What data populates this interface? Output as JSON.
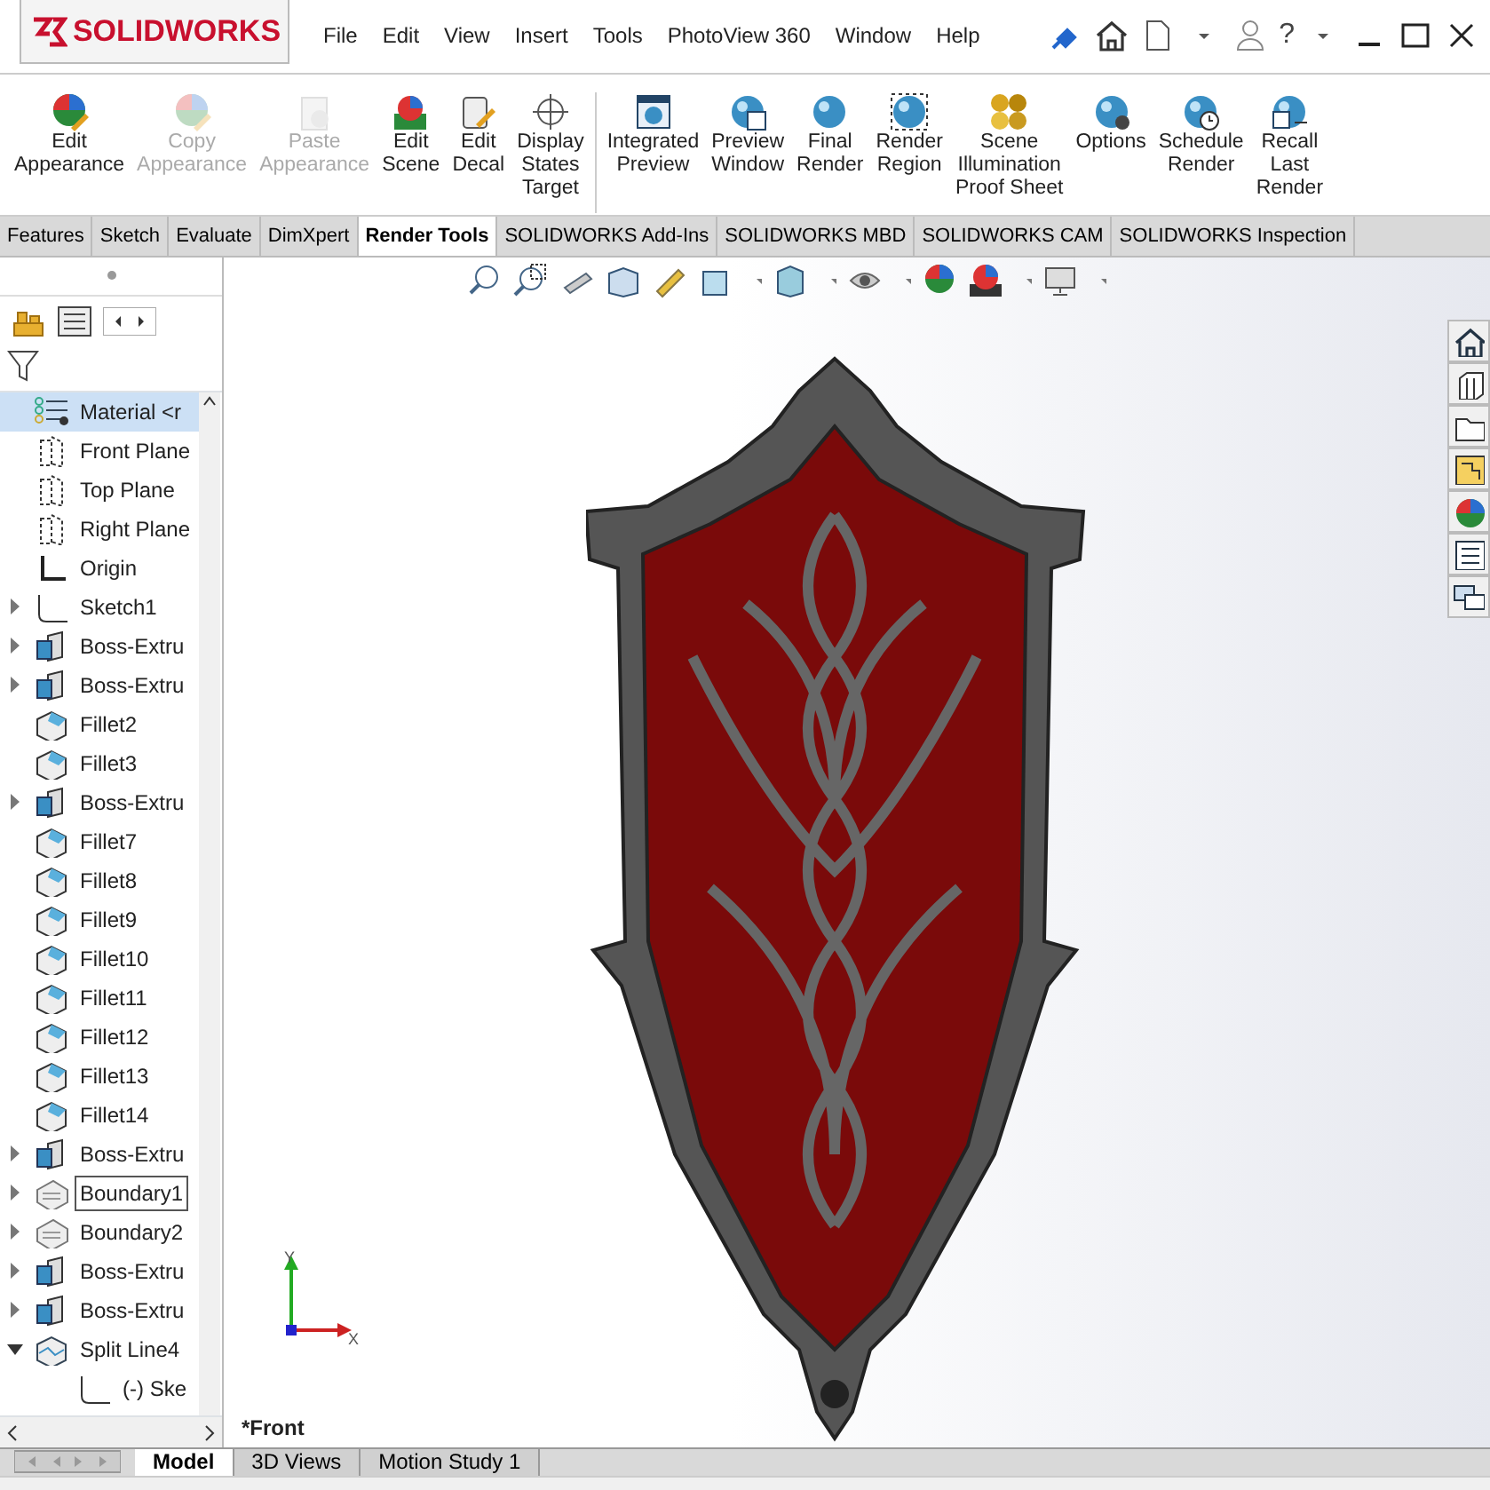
{
  "app": {
    "logo": "SOLIDWORKS",
    "help": "?"
  },
  "menu": [
    "File",
    "Edit",
    "View",
    "Insert",
    "Tools",
    "PhotoView 360",
    "Window",
    "Help"
  ],
  "ribbon": {
    "groups": [
      [
        {
          "label": "Edit\nAppearance",
          "kind": "appearance",
          "disabled": false
        },
        {
          "label": "Copy\nAppearance",
          "kind": "appearance",
          "disabled": true
        },
        {
          "label": "Paste\nAppearance",
          "kind": "paste",
          "disabled": true
        },
        {
          "label": "Edit\nScene",
          "kind": "scene",
          "disabled": false
        },
        {
          "label": "Edit\nDecal",
          "kind": "decal",
          "disabled": false
        },
        {
          "label": "Display\nStates\nTarget",
          "kind": "target",
          "disabled": false
        }
      ],
      [
        {
          "label": "Integrated\nPreview",
          "kind": "preview",
          "disabled": false
        },
        {
          "label": "Preview\nWindow",
          "kind": "window",
          "disabled": false
        },
        {
          "label": "Final\nRender",
          "kind": "sphere",
          "disabled": false
        },
        {
          "label": "Render\nRegion",
          "kind": "region",
          "disabled": false
        },
        {
          "label": "Scene\nIllumination\nProof Sheet",
          "kind": "proof",
          "disabled": false
        },
        {
          "label": "Options",
          "kind": "options",
          "disabled": false
        },
        {
          "label": "Schedule\nRender",
          "kind": "clock",
          "disabled": false
        },
        {
          "label": "Recall\nLast\nRender",
          "kind": "recall",
          "disabled": false
        }
      ]
    ]
  },
  "tabs": [
    {
      "label": "Features",
      "selected": false
    },
    {
      "label": "Sketch",
      "selected": false
    },
    {
      "label": "Evaluate",
      "selected": false
    },
    {
      "label": "DimXpert",
      "selected": false
    },
    {
      "label": "Render Tools",
      "selected": true
    },
    {
      "label": "SOLIDWORKS Add-Ins",
      "selected": false
    },
    {
      "label": "SOLIDWORKS MBD",
      "selected": false
    },
    {
      "label": "SOLIDWORKS CAM",
      "selected": false
    },
    {
      "label": "SOLIDWORKS Inspection",
      "selected": false
    }
  ],
  "tree": [
    {
      "label": "Material <r",
      "kind": "material",
      "selected": true,
      "focused": false
    },
    {
      "label": "Front Plane",
      "kind": "plane",
      "selected": false,
      "focused": false
    },
    {
      "label": "Top Plane",
      "kind": "plane",
      "selected": false,
      "focused": false
    },
    {
      "label": "Right Plane",
      "kind": "plane",
      "selected": false,
      "focused": false
    },
    {
      "label": "Origin",
      "kind": "origin",
      "selected": false,
      "focused": false
    },
    {
      "label": "Sketch1",
      "kind": "sketch",
      "expanded": false,
      "selected": false,
      "focused": false
    },
    {
      "label": "Boss-Extru",
      "kind": "extrude",
      "expanded": false,
      "selected": false,
      "focused": false
    },
    {
      "label": "Boss-Extru",
      "kind": "extrude",
      "expanded": false,
      "selected": false,
      "focused": false
    },
    {
      "label": "Fillet2",
      "kind": "fillet",
      "selected": false,
      "focused": false
    },
    {
      "label": "Fillet3",
      "kind": "fillet",
      "selected": false,
      "focused": false
    },
    {
      "label": "Boss-Extru",
      "kind": "extrude",
      "expanded": false,
      "selected": false,
      "focused": false
    },
    {
      "label": "Fillet7",
      "kind": "fillet",
      "selected": false,
      "focused": false
    },
    {
      "label": "Fillet8",
      "kind": "fillet",
      "selected": false,
      "focused": false
    },
    {
      "label": "Fillet9",
      "kind": "fillet",
      "selected": false,
      "focused": false
    },
    {
      "label": "Fillet10",
      "kind": "fillet",
      "selected": false,
      "focused": false
    },
    {
      "label": "Fillet11",
      "kind": "fillet",
      "selected": false,
      "focused": false
    },
    {
      "label": "Fillet12",
      "kind": "fillet",
      "selected": false,
      "focused": false
    },
    {
      "label": "Fillet13",
      "kind": "fillet",
      "selected": false,
      "focused": false
    },
    {
      "label": "Fillet14",
      "kind": "fillet",
      "selected": false,
      "focused": false
    },
    {
      "label": "Boss-Extru",
      "kind": "extrude",
      "expanded": false,
      "selected": false,
      "focused": false
    },
    {
      "label": "Boundary1",
      "kind": "boundary",
      "expanded": false,
      "selected": false,
      "focused": true
    },
    {
      "label": "Boundary2",
      "kind": "boundary",
      "expanded": false,
      "selected": false,
      "focused": false
    },
    {
      "label": "Boss-Extru",
      "kind": "extrude",
      "expanded": false,
      "selected": false,
      "focused": false
    },
    {
      "label": "Boss-Extru",
      "kind": "extrude",
      "expanded": false,
      "selected": false,
      "focused": false
    },
    {
      "label": "Split Line4",
      "kind": "split",
      "expanded": true,
      "selected": false,
      "focused": false,
      "children": [
        {
          "label": "(-) Ske",
          "kind": "sketch",
          "selected": false,
          "focused": false
        }
      ]
    }
  ],
  "viewport": {
    "view_name": "*Front",
    "axis_labels": [
      "Y",
      "X"
    ]
  },
  "bottom_tabs": [
    {
      "label": "Model",
      "selected": true
    },
    {
      "label": "3D Views",
      "selected": false
    },
    {
      "label": "Motion Study 1",
      "selected": false
    }
  ]
}
